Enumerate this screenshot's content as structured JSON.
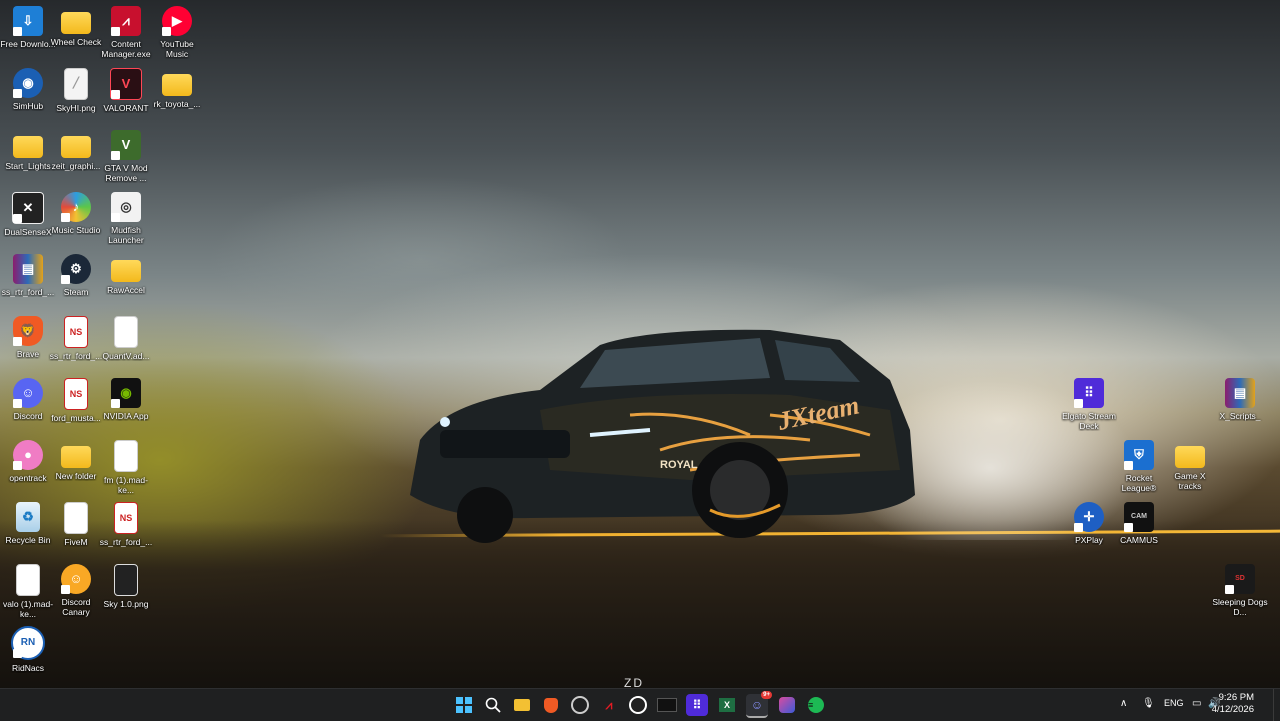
{
  "desktop_icons": {
    "free_download_manager": "Free Downlo...",
    "wheel_check": "Wheel Check",
    "content_manager": "Content Manager.exe",
    "youtube_music": "YouTube Music",
    "simhub": "SimHub",
    "skyhi": "SkyHI.png",
    "valorant": "VALORANT",
    "rk_toyota": "rk_toyota_...",
    "start_lights": "Start_Lights",
    "zeit_graphics": "zeit_graphi...",
    "gta_v_mod_remove": "GTA V Mod Remove ...",
    "dualsensex": "DualSenseX",
    "music_studio": "Music Studio",
    "mudfish_launcher": "Mudfish Launcher",
    "ss_rtr_ford_1": "ss_rtr_ford_...",
    "steam": "Steam",
    "rawaccel": "RawAccel",
    "brave": "Brave",
    "ss_rtr_ford_2": "ss_rtr_ford_...",
    "quantv": "QuantV.ad...",
    "discord": "Discord",
    "ford_mustang": "ford_musta...",
    "nvidia_app": "NVIDIA App",
    "opentrack": "opentrack",
    "new_folder": "New folder",
    "fm_mad_ke": "fm (1).mad-ke...",
    "recycle_bin": "Recycle Bin",
    "fivem": "FiveM",
    "ss_rtr_ford_3": "ss_rtr_ford_...",
    "valo_mad_ke": "valo (1).mad-ke...",
    "discord_canary": "Discord Canary",
    "sky_1_0": "Sky 1.0.png",
    "ridnacs": "RidNacs",
    "elgato_stream_deck": "Elgato Stream Deck",
    "winrar_right": "X_Scripts_",
    "rocket_league": "Rocket League®",
    "game_x_tracks": "Game X tracks",
    "pxplay": "PXPlay",
    "cammus": "CAMMUS",
    "sleeping_dogs": "Sleeping Dogs D..."
  },
  "wallpaper": {
    "car_livery_text": "JXteam",
    "car_sponsor_text": "ROYAL",
    "watermark": "ZD"
  },
  "taskbar": {
    "language": "ENG",
    "time": "9:26 PM",
    "date": "4/12/2026",
    "discord_badge": "9+"
  },
  "colors": {
    "taskbar_bg": "#1f2021",
    "road_line": "#f0b030",
    "folder": "#f3b91c"
  }
}
